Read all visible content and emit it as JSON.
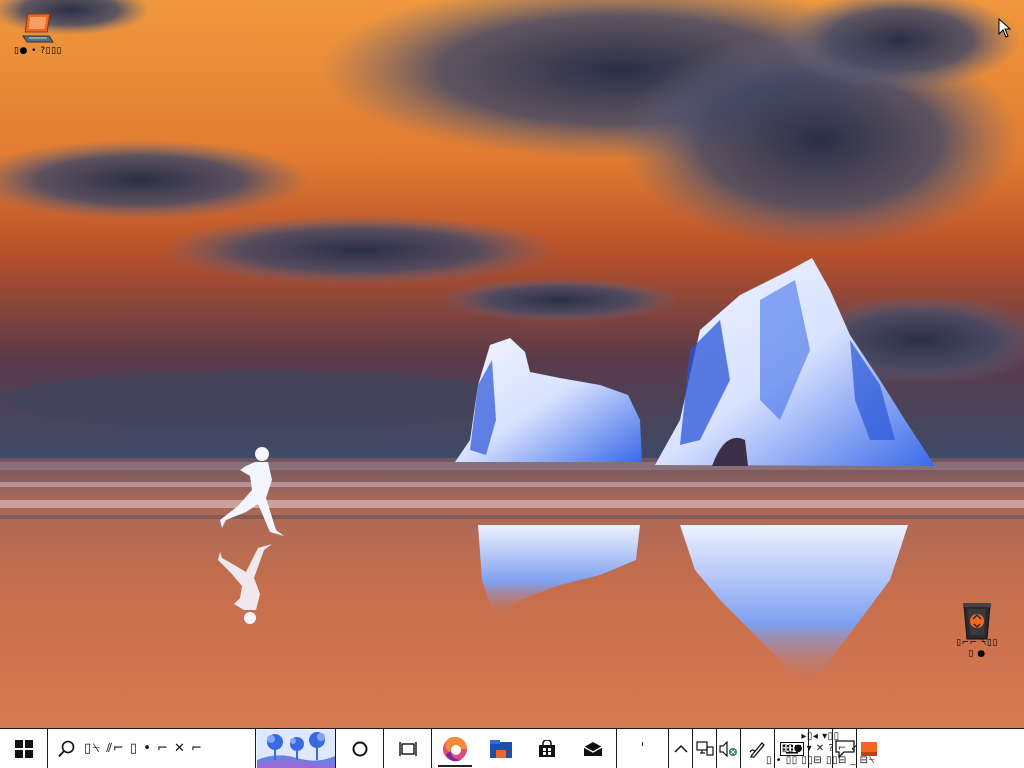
{
  "desktop": {
    "icons": [
      {
        "name": "this-pc",
        "label": "▯● • ?▯▯▯"
      },
      {
        "name": "recycle-bin",
        "label_line1": "▯⌐⌐ ⍀▯▯",
        "label_line2": "▯ ●"
      }
    ]
  },
  "taskbar": {
    "search_text": "▯⍀ ⫽⌐ ▯ • ⌐ ✕ ⌐",
    "spacer_glyph": "ˈ",
    "clock_line1": "▸▯◂ ▾▯▯",
    "clock_line2": "▯▯● ▾ ✕ ? ⌐ ✓",
    "clock_line3": "▯ • ▯▯ ▯▯⊟ ▯▯⊟ _ ⊟⍀"
  },
  "colors": {
    "sky_top": "#e8893a",
    "sky_mid": "#c05a2a",
    "horizon": "#3d4a68",
    "sea": "#c96f4e",
    "ice_white": "#eef2ff",
    "ice_blue": "#2f5fe0",
    "edge_orange": "#f26522",
    "taskbar_bg": "#ffffff"
  },
  "icons": {
    "start": "windows-logo-icon",
    "search": "search-icon",
    "cortana": "cortana-circle-icon",
    "taskview": "task-view-icon",
    "edge": "edge-browser-icon",
    "explorer": "file-explorer-icon",
    "store": "store-icon",
    "mail": "mail-icon",
    "tray_chevron": "chevron-up-icon",
    "network": "network-icon",
    "volume": "volume-muted-icon",
    "pen": "pen-icon",
    "keyboard": "touch-keyboard-icon",
    "notification": "notification-icon"
  }
}
